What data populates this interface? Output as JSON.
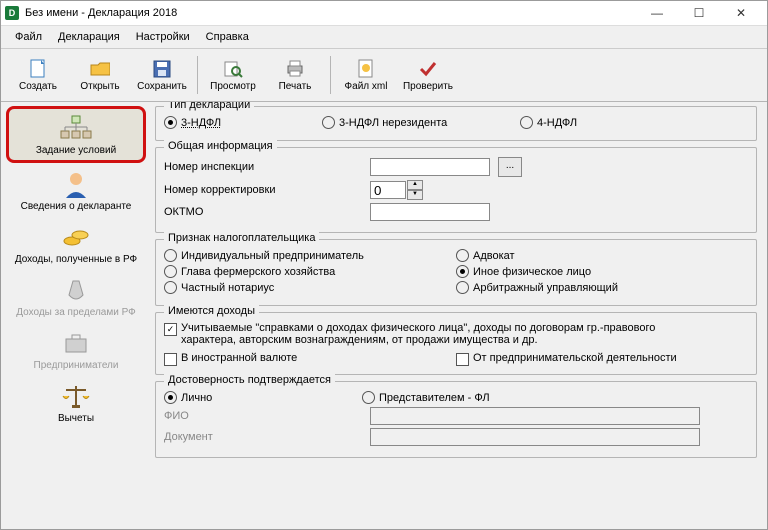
{
  "window": {
    "title": "Без имени - Декларация 2018"
  },
  "menu": {
    "items": [
      "Файл",
      "Декларация",
      "Настройки",
      "Справка"
    ]
  },
  "toolbar": {
    "create": "Создать",
    "open": "Открыть",
    "save": "Сохранить",
    "preview": "Просмотр",
    "print": "Печать",
    "xml": "Файл xml",
    "check": "Проверить"
  },
  "sidebar": {
    "items": [
      {
        "label": "Задание условий"
      },
      {
        "label": "Сведения о декларанте"
      },
      {
        "label": "Доходы, полученные в РФ"
      },
      {
        "label": "Доходы за пределами РФ"
      },
      {
        "label": "Предприниматели"
      },
      {
        "label": "Вычеты"
      }
    ]
  },
  "decl_type": {
    "legend": "Тип декларации",
    "opt1": "3-НДФЛ",
    "opt2": "3-НДФЛ нерезидента",
    "opt3": "4-НДФЛ"
  },
  "general": {
    "legend": "Общая информация",
    "inspect": "Номер инспекции",
    "corr": "Номер корректировки",
    "corr_val": "0",
    "oktmo": "ОКТМО",
    "browse": "..."
  },
  "payer": {
    "legend": "Признак налогоплательщика",
    "opt_ip": "Индивидуальный предприниматель",
    "opt_adv": "Адвокат",
    "opt_farm": "Глава фермерского хозяйства",
    "opt_phys": "Иное физическое лицо",
    "opt_not": "Частный нотариус",
    "opt_arb": "Арбитражный управляющий"
  },
  "income": {
    "legend": "Имеются доходы",
    "chk_main": "Учитываемые \"справками о доходах физического лица\", доходы по договорам гр.-правового характера, авторским вознаграждениям, от продажи имущества и др.",
    "chk_foreign": "В иностранной валюте",
    "chk_biz": "От предпринимательской деятельности"
  },
  "trust": {
    "legend": "Достоверность подтверждается",
    "opt_self": "Лично",
    "opt_rep": "Представителем - ФЛ",
    "fio": "ФИО",
    "doc": "Документ"
  }
}
